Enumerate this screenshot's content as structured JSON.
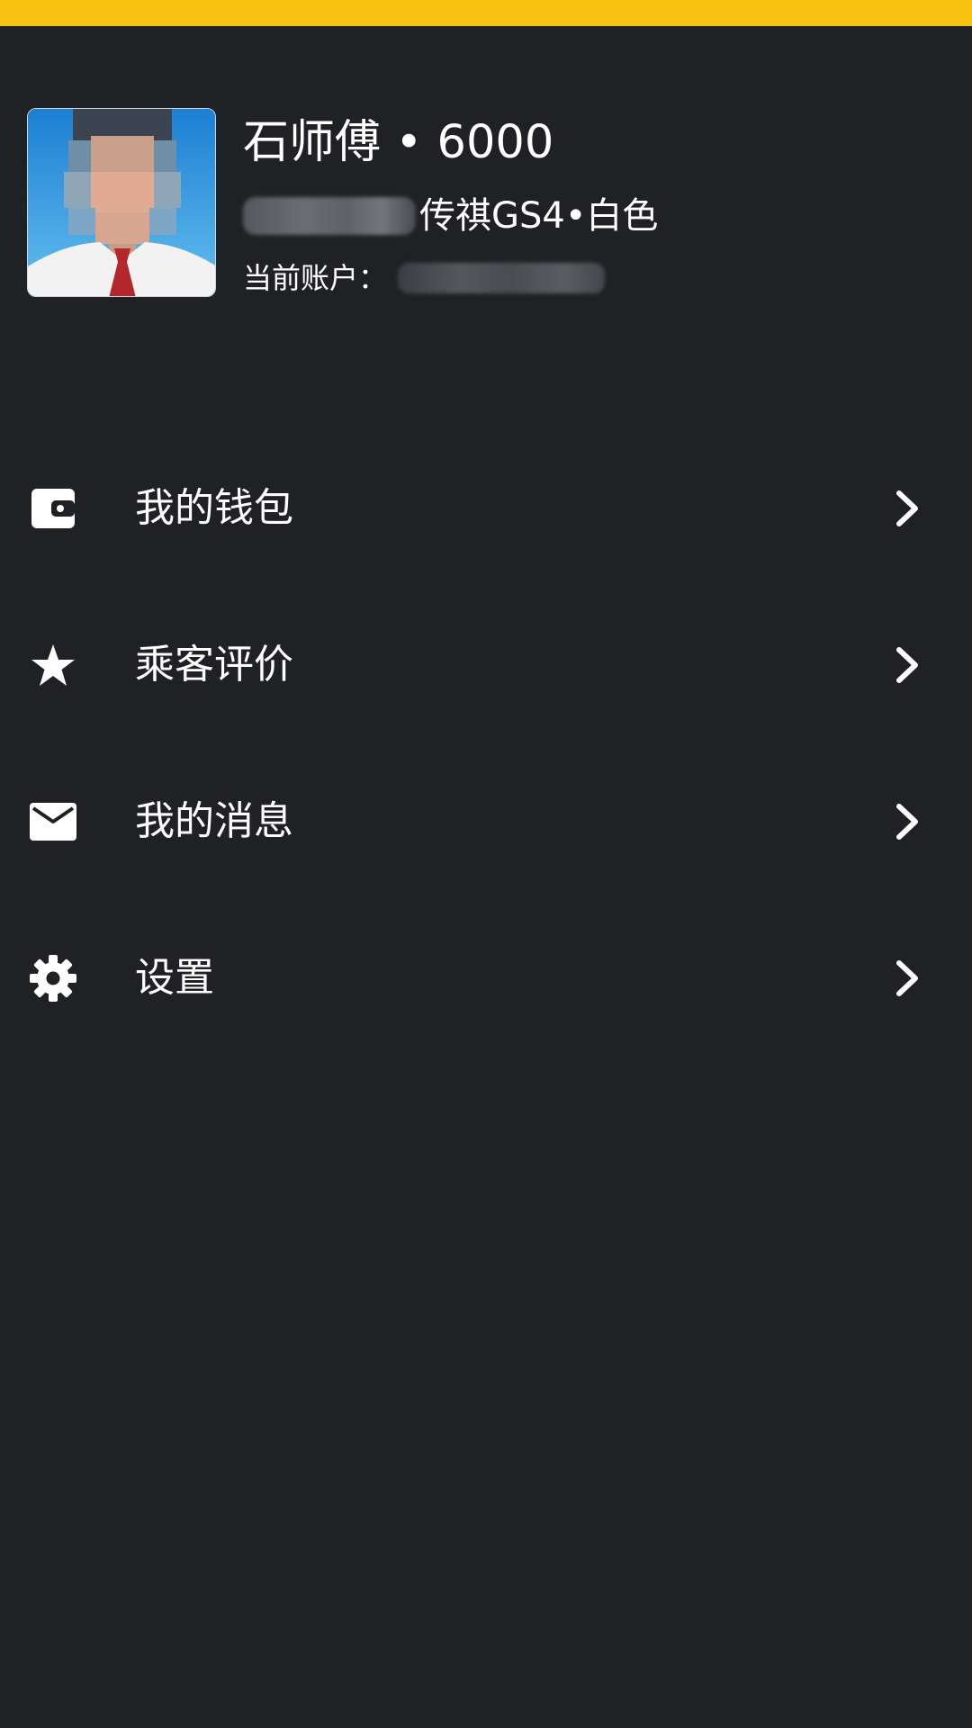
{
  "status_bar": {
    "color": "#f8c112"
  },
  "profile": {
    "name": "石师傅 • 6000",
    "car_description": "传祺GS4•白色",
    "account_label": "当前账户："
  },
  "menu": {
    "items": [
      {
        "label": "我的钱包",
        "icon": "wallet-icon"
      },
      {
        "label": "乘客评价",
        "icon": "star-icon"
      },
      {
        "label": "我的消息",
        "icon": "mail-icon"
      },
      {
        "label": "设置",
        "icon": "gear-icon"
      }
    ]
  },
  "colors": {
    "background": "#202125",
    "text": "#ffffff",
    "accent": "#f8c112"
  }
}
